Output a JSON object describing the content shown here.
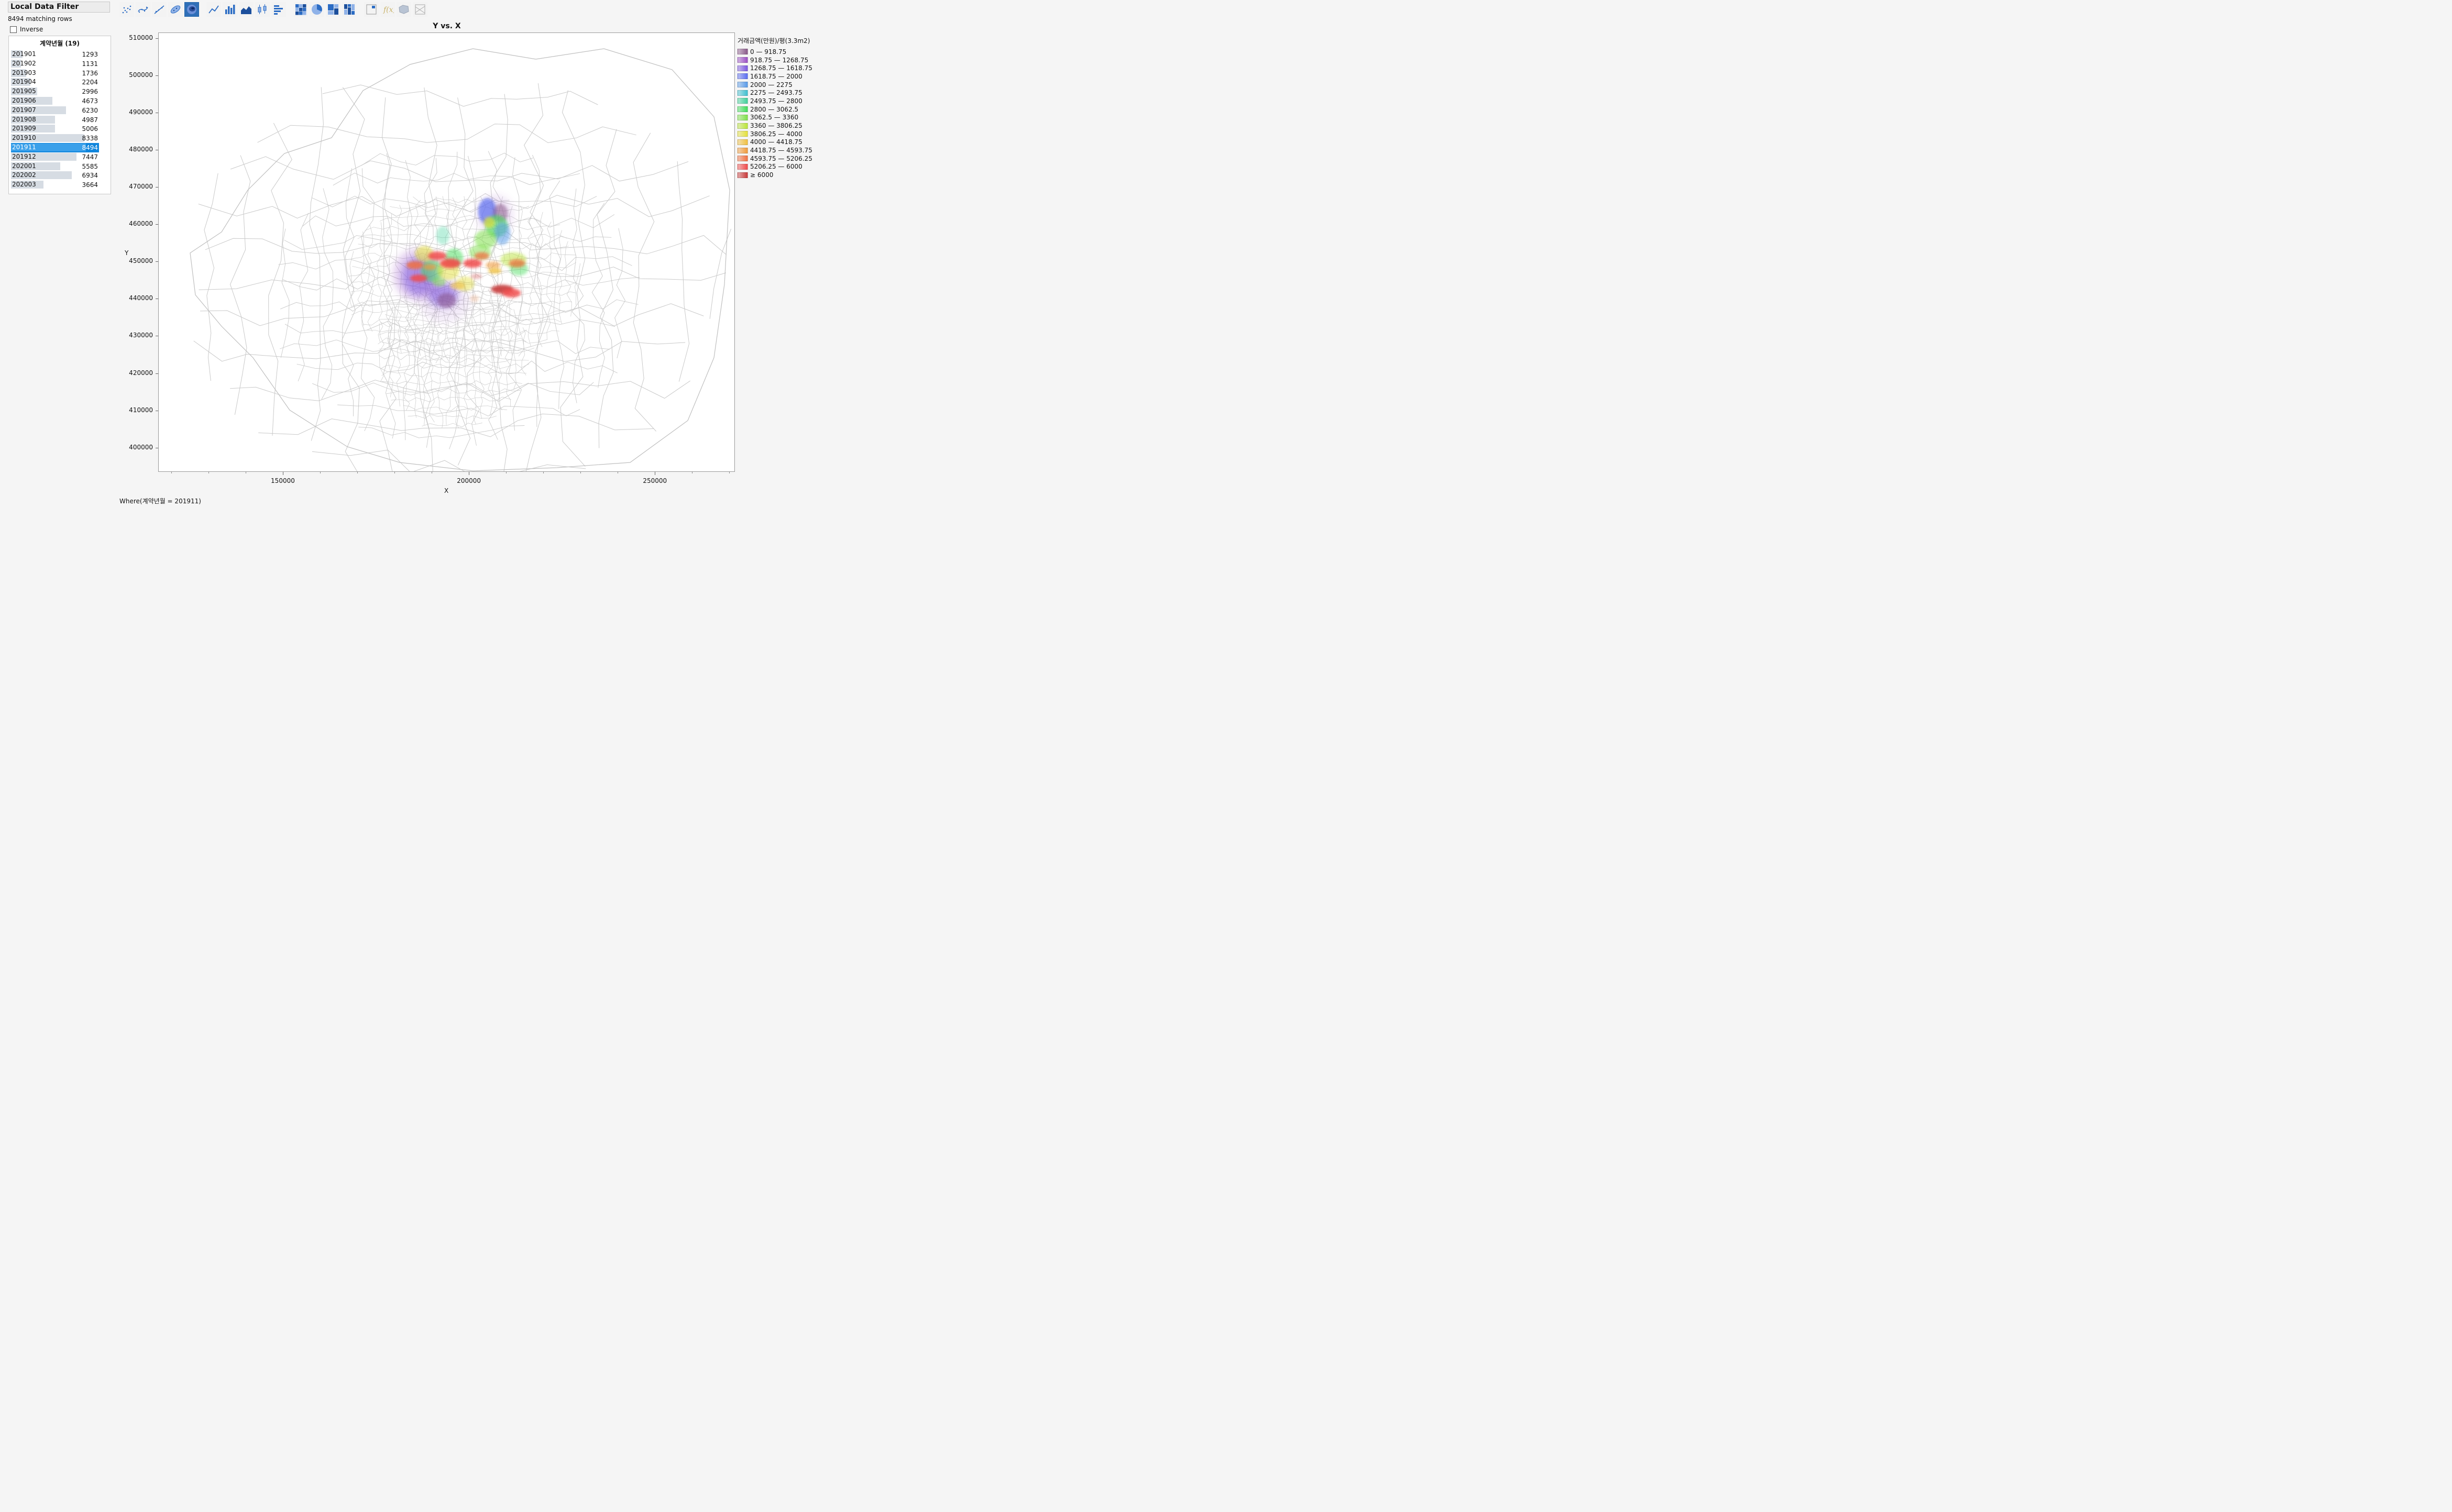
{
  "filter": {
    "title": "Local Data Filter",
    "matching": "8494 matching rows",
    "inverse_label": "Inverse",
    "inverse_checked": false,
    "column_header": "계약년월 (19)",
    "rows": [
      {
        "label": "201901",
        "count": "1293",
        "value": 1293
      },
      {
        "label": "201902",
        "count": "1131",
        "value": 1131
      },
      {
        "label": "201903",
        "count": "1736",
        "value": 1736
      },
      {
        "label": "201904",
        "count": "2204",
        "value": 2204
      },
      {
        "label": "201905",
        "count": "2996",
        "value": 2996
      },
      {
        "label": "201906",
        "count": "4673",
        "value": 4673
      },
      {
        "label": "201907",
        "count": "6230",
        "value": 6230
      },
      {
        "label": "201908",
        "count": "4987",
        "value": 4987
      },
      {
        "label": "201909",
        "count": "5006",
        "value": 5006
      },
      {
        "label": "201910",
        "count": "8338",
        "value": 8338
      },
      {
        "label": "201911",
        "count": "8494",
        "value": 8494,
        "selected": true
      },
      {
        "label": "201912",
        "count": "7447",
        "value": 7447
      },
      {
        "label": "202001",
        "count": "5585",
        "value": 5585
      },
      {
        "label": "202002",
        "count": "6934",
        "value": 6934
      },
      {
        "label": "202003",
        "count": "3664",
        "value": 3664
      }
    ],
    "max_value": 10000
  },
  "toolbar": {
    "buttons": [
      {
        "name": "points-icon"
      },
      {
        "name": "smoother-icon"
      },
      {
        "name": "line-of-fit-icon"
      },
      {
        "name": "ellipse-icon"
      },
      {
        "name": "contour-icon",
        "active": true
      },
      {
        "name": "line-icon"
      },
      {
        "name": "bar-icon"
      },
      {
        "name": "area-icon"
      },
      {
        "name": "box-plot-icon"
      },
      {
        "name": "histogram-icon"
      },
      {
        "name": "heatmap-icon"
      },
      {
        "name": "pie-icon"
      },
      {
        "name": "treemap-icon"
      },
      {
        "name": "mosaic-icon"
      },
      {
        "name": "caption-box-icon"
      },
      {
        "name": "formula-icon"
      },
      {
        "name": "map-shape-icon"
      },
      {
        "name": "parallel-icon"
      }
    ]
  },
  "graph": {
    "title": "Y vs. X",
    "xlabel": "X",
    "ylabel": "Y",
    "where": "Where(계약년월 = 201911)"
  },
  "chart_data": {
    "type": "heatmap",
    "title": "Y vs. X",
    "xlabel": "X",
    "ylabel": "Y",
    "xlim": [
      116500,
      271500
    ],
    "ylim": [
      393500,
      511500
    ],
    "x_ticks": [
      150000,
      200000,
      250000
    ],
    "y_ticks": [
      400000,
      410000,
      420000,
      430000,
      440000,
      450000,
      460000,
      470000,
      480000,
      490000,
      500000,
      510000
    ],
    "legend_title": "거래금액(만원)/평(3.3m2)",
    "legend": [
      {
        "label": "0 — 918.75",
        "color": "#8a5a8a"
      },
      {
        "label": "918.75 — 1268.75",
        "color": "#9b4fc4"
      },
      {
        "label": "1268.75 — 1618.75",
        "color": "#7b57e0"
      },
      {
        "label": "1618.75 — 2000",
        "color": "#5a6cf0"
      },
      {
        "label": "2000 — 2275",
        "color": "#5a9be8"
      },
      {
        "label": "2275 — 2493.75",
        "color": "#3fbfd0"
      },
      {
        "label": "2493.75 — 2800",
        "color": "#3fd09a"
      },
      {
        "label": "2800 — 3062.5",
        "color": "#3fdc58"
      },
      {
        "label": "3062.5 — 3360",
        "color": "#7fe04a"
      },
      {
        "label": "3360 — 3806.25",
        "color": "#b9e43a"
      },
      {
        "label": "3806.25 — 4000",
        "color": "#e4e03a"
      },
      {
        "label": "4000 — 4418.75",
        "color": "#f0c040"
      },
      {
        "label": "4418.75 — 4593.75",
        "color": "#f09a3a"
      },
      {
        "label": "4593.75 — 5206.25",
        "color": "#f07040"
      },
      {
        "label": "5206.25 — 6000",
        "color": "#f04a4a"
      },
      {
        "label": "≥ 6000",
        "color": "#c83a3a"
      }
    ],
    "blobs": [
      {
        "x": 186000,
        "y": 446500,
        "rx": 6500,
        "ry": 7000,
        "color": "#9b4fc4",
        "opacity": 0.25
      },
      {
        "x": 186500,
        "y": 446000,
        "rx": 4500,
        "ry": 5200,
        "color": "#7b57e0",
        "opacity": 0.55
      },
      {
        "x": 193000,
        "y": 441000,
        "rx": 4000,
        "ry": 3200,
        "color": "#7b57e0",
        "opacity": 0.6
      },
      {
        "x": 194000,
        "y": 439500,
        "rx": 2500,
        "ry": 2000,
        "color": "#8a5a8a",
        "opacity": 0.6
      },
      {
        "x": 193500,
        "y": 439500,
        "rx": 7000,
        "ry": 6000,
        "color": "#9b4fc4",
        "opacity": 0.12
      },
      {
        "x": 207000,
        "y": 462500,
        "rx": 5000,
        "ry": 5500,
        "color": "#9b4fc4",
        "opacity": 0.15
      },
      {
        "x": 205000,
        "y": 463500,
        "rx": 2500,
        "ry": 3500,
        "color": "#5a6cf0",
        "opacity": 0.7
      },
      {
        "x": 208500,
        "y": 463000,
        "rx": 2000,
        "ry": 2500,
        "color": "#8a5a8a",
        "opacity": 0.55
      },
      {
        "x": 207500,
        "y": 459500,
        "rx": 3000,
        "ry": 3000,
        "color": "#3fdc58",
        "opacity": 0.6
      },
      {
        "x": 209000,
        "y": 457500,
        "rx": 2200,
        "ry": 3000,
        "color": "#5a9be8",
        "opacity": 0.55
      },
      {
        "x": 204500,
        "y": 456000,
        "rx": 3000,
        "ry": 2500,
        "color": "#7fe04a",
        "opacity": 0.55
      },
      {
        "x": 205500,
        "y": 460500,
        "rx": 1500,
        "ry": 1500,
        "color": "#e4e03a",
        "opacity": 0.7
      },
      {
        "x": 193000,
        "y": 457000,
        "rx": 1800,
        "ry": 2500,
        "color": "#3fd09a",
        "opacity": 0.35
      },
      {
        "x": 190000,
        "y": 447500,
        "rx": 3000,
        "ry": 3000,
        "color": "#3fdc58",
        "opacity": 0.5
      },
      {
        "x": 196000,
        "y": 451000,
        "rx": 2500,
        "ry": 2500,
        "color": "#3fdc58",
        "opacity": 0.5
      },
      {
        "x": 203000,
        "y": 452500,
        "rx": 3000,
        "ry": 2000,
        "color": "#7fe04a",
        "opacity": 0.5
      },
      {
        "x": 212000,
        "y": 450500,
        "rx": 3500,
        "ry": 2000,
        "color": "#b9e43a",
        "opacity": 0.5
      },
      {
        "x": 213500,
        "y": 448000,
        "rx": 2500,
        "ry": 1800,
        "color": "#3fdc58",
        "opacity": 0.45
      },
      {
        "x": 188000,
        "y": 452000,
        "rx": 2500,
        "ry": 2200,
        "color": "#e4e03a",
        "opacity": 0.55
      },
      {
        "x": 194500,
        "y": 447500,
        "rx": 3000,
        "ry": 2500,
        "color": "#e4e03a",
        "opacity": 0.5
      },
      {
        "x": 199000,
        "y": 444000,
        "rx": 2500,
        "ry": 2000,
        "color": "#e4e03a",
        "opacity": 0.45
      },
      {
        "x": 185500,
        "y": 449000,
        "rx": 2300,
        "ry": 1100,
        "color": "#f07040",
        "opacity": 0.85
      },
      {
        "x": 186500,
        "y": 445500,
        "rx": 2300,
        "ry": 1000,
        "color": "#f04a4a",
        "opacity": 0.85
      },
      {
        "x": 191500,
        "y": 451500,
        "rx": 2500,
        "ry": 1200,
        "color": "#f04a4a",
        "opacity": 0.85
      },
      {
        "x": 189500,
        "y": 448500,
        "rx": 1800,
        "ry": 800,
        "color": "#f09a3a",
        "opacity": 0.7
      },
      {
        "x": 195000,
        "y": 449500,
        "rx": 2800,
        "ry": 1300,
        "color": "#f04a4a",
        "opacity": 0.9
      },
      {
        "x": 201000,
        "y": 449500,
        "rx": 2500,
        "ry": 1200,
        "color": "#f04a4a",
        "opacity": 0.85
      },
      {
        "x": 203500,
        "y": 451500,
        "rx": 2000,
        "ry": 1000,
        "color": "#f07040",
        "opacity": 0.75
      },
      {
        "x": 206500,
        "y": 449000,
        "rx": 2000,
        "ry": 1000,
        "color": "#f09a3a",
        "opacity": 0.6
      },
      {
        "x": 213000,
        "y": 449500,
        "rx": 2200,
        "ry": 1100,
        "color": "#f07040",
        "opacity": 0.75
      },
      {
        "x": 207000,
        "y": 447500,
        "rx": 1800,
        "ry": 800,
        "color": "#f0c040",
        "opacity": 0.8
      },
      {
        "x": 202000,
        "y": 446000,
        "rx": 1500,
        "ry": 700,
        "color": "#c83a3a",
        "opacity": 0.35
      },
      {
        "x": 209000,
        "y": 442500,
        "rx": 3000,
        "ry": 1200,
        "color": "#c83a3a",
        "opacity": 0.9
      },
      {
        "x": 211500,
        "y": 441500,
        "rx": 2500,
        "ry": 1200,
        "color": "#f04a4a",
        "opacity": 0.85
      },
      {
        "x": 201500,
        "y": 440000,
        "rx": 1200,
        "ry": 900,
        "color": "#f0c0a0",
        "opacity": 0.5
      },
      {
        "x": 197000,
        "y": 443500,
        "rx": 2000,
        "ry": 1000,
        "color": "#f0c040",
        "opacity": 0.6
      },
      {
        "x": 192000,
        "y": 444500,
        "rx": 1800,
        "ry": 1200,
        "color": "#7fe04a",
        "opacity": 0.5
      }
    ]
  }
}
